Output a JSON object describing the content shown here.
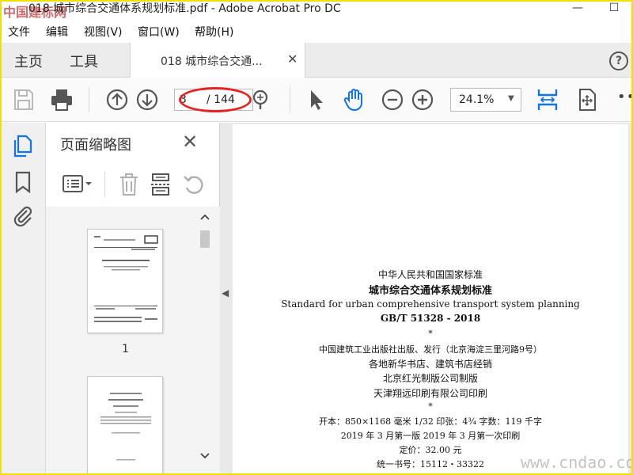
{
  "window": {
    "title": "018 城市综合交通体系规划标准.pdf - Adobe Acrobat Pro DC",
    "watermark_logo": "中国建标网",
    "minimize": "—",
    "maximize": "☐"
  },
  "menu": [
    "文件",
    "编辑",
    "视图(V)",
    "窗口(W)",
    "帮助(H)"
  ],
  "nav_tabs": {
    "home": "主页",
    "tools": "工具"
  },
  "doc_tab": {
    "label": "018 城市综合交通...",
    "close": "✕"
  },
  "help": "?",
  "toolbar": {
    "current_page": "3",
    "total_pages": "/ 144",
    "zoom": "24.1%",
    "zoom_dropdown": "▼",
    "more": "•••"
  },
  "thumbnail_panel": {
    "title": "页面缩略图",
    "close": "✕",
    "pages": [
      {
        "number": "1"
      },
      {
        "number": ""
      }
    ]
  },
  "collapse_arrow": "◀",
  "document_page": {
    "issuer": "中华人民共和国国家标准",
    "title_cn": "城市综合交通体系规划标准",
    "title_en": "Standard for urban comprehensive transport system planning",
    "code": "GB/T 51328 - 2018",
    "star1": "*",
    "publisher": "中国建筑工业出版社出版、发行（北京海淀三里河路9号）",
    "distributors": "各地新华书店、建筑书店经销",
    "maker": "北京红光制版公司制版",
    "printer": "天津翔远印刷有限公司印刷",
    "star2": "*",
    "format": "开本：850×1168 毫米  1/32  印张：4¾  字数：119 千字",
    "edition": "2019 年 3 月第一版    2019 年 3 月第一次印刷",
    "price": "定价：32.00 元",
    "book_number": "统一书号：15112・33322"
  },
  "watermark_bottom": "www.cndao.com",
  "colors": {
    "frame_border": "#f2e000",
    "annotation_red": "#e52323",
    "hand_tool_blue": "#1473e6"
  }
}
